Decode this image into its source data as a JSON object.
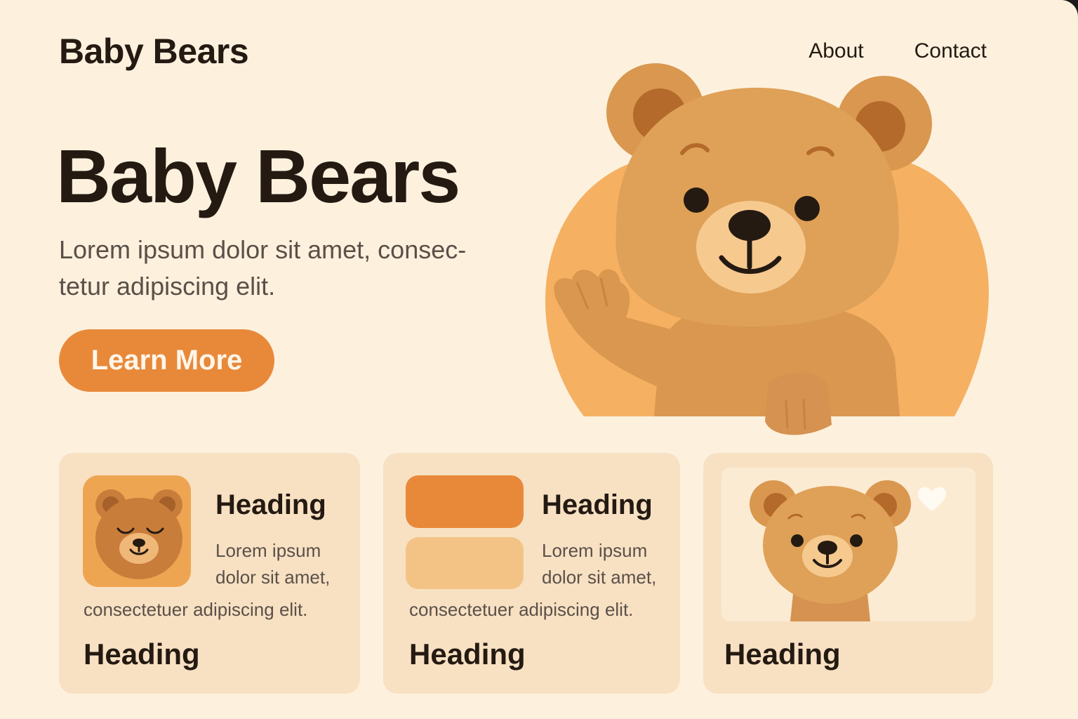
{
  "header": {
    "brand": "Baby Bears",
    "nav": [
      {
        "label": "About"
      },
      {
        "label": "Contact"
      }
    ]
  },
  "hero": {
    "title": "Baby Bears",
    "text": "Lorem ipsum dolor sit amet, consec- tetur adipiscing elit.",
    "cta": "Learn More"
  },
  "cards": [
    {
      "heading": "Heading",
      "text_a": "Lorem ipsum dolor sit amet,",
      "text_b": "consectetuer adipiscing elit.",
      "footer": "Heading"
    },
    {
      "heading": "Heading",
      "text_a": "Lorem ipsum dolor sit amet,",
      "text_b": "consectetuer adipiscing elit.",
      "footer": "Heading"
    },
    {
      "footer": "Heading"
    }
  ],
  "colors": {
    "background": "#fdf1de",
    "accent": "#e8893a",
    "card": "#f8e1c3",
    "bear": "#db9d55",
    "text": "#241a12"
  }
}
